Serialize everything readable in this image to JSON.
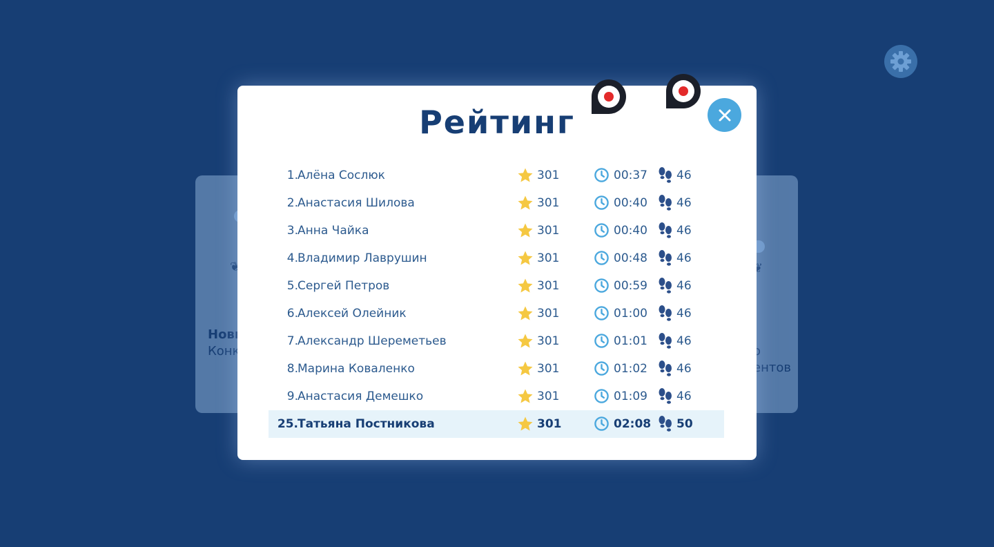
{
  "modal": {
    "title": "Рейтинг"
  },
  "background_cards": {
    "left": {
      "line1": "Нови",
      "line2": "Конк"
    },
    "right": {
      "line1": "о",
      "line2": "ентов"
    }
  },
  "colors": {
    "background": "#173e74",
    "accent": "#4ba8de",
    "star": "#f5c842",
    "text": "#2c5a8e",
    "highlight_row": "#e6f3fa"
  },
  "icons": {
    "settings": "gear-icon",
    "close": "close-icon",
    "score": "star-icon",
    "time": "clock-icon",
    "steps": "footprints-icon",
    "record": "record-icon"
  },
  "leaderboard": {
    "rows": [
      {
        "rank": "1.",
        "name": "Алёна Сослюк",
        "score": "301",
        "time": "00:37",
        "steps": "46"
      },
      {
        "rank": "2.",
        "name": "Анастасия Шилова",
        "score": "301",
        "time": "00:40",
        "steps": "46"
      },
      {
        "rank": "3.",
        "name": "Анна Чайка",
        "score": "301",
        "time": "00:40",
        "steps": "46"
      },
      {
        "rank": "4.",
        "name": "Владимир Лаврушин",
        "score": "301",
        "time": "00:48",
        "steps": "46"
      },
      {
        "rank": "5.",
        "name": "Сергей Петров",
        "score": "301",
        "time": "00:59",
        "steps": "46"
      },
      {
        "rank": "6.",
        "name": "Алексей Олейник",
        "score": "301",
        "time": "01:00",
        "steps": "46"
      },
      {
        "rank": "7.",
        "name": "Александр Шереметьев",
        "score": "301",
        "time": "01:01",
        "steps": "46"
      },
      {
        "rank": "8.",
        "name": "Марина Коваленко",
        "score": "301",
        "time": "01:02",
        "steps": "46"
      },
      {
        "rank": "9.",
        "name": "Анастасия Демешко",
        "score": "301",
        "time": "01:09",
        "steps": "46"
      }
    ],
    "current_user": {
      "rank": "25.",
      "name": "Татьяна Постникова",
      "score": "301",
      "time": "02:08",
      "steps": "50"
    }
  }
}
